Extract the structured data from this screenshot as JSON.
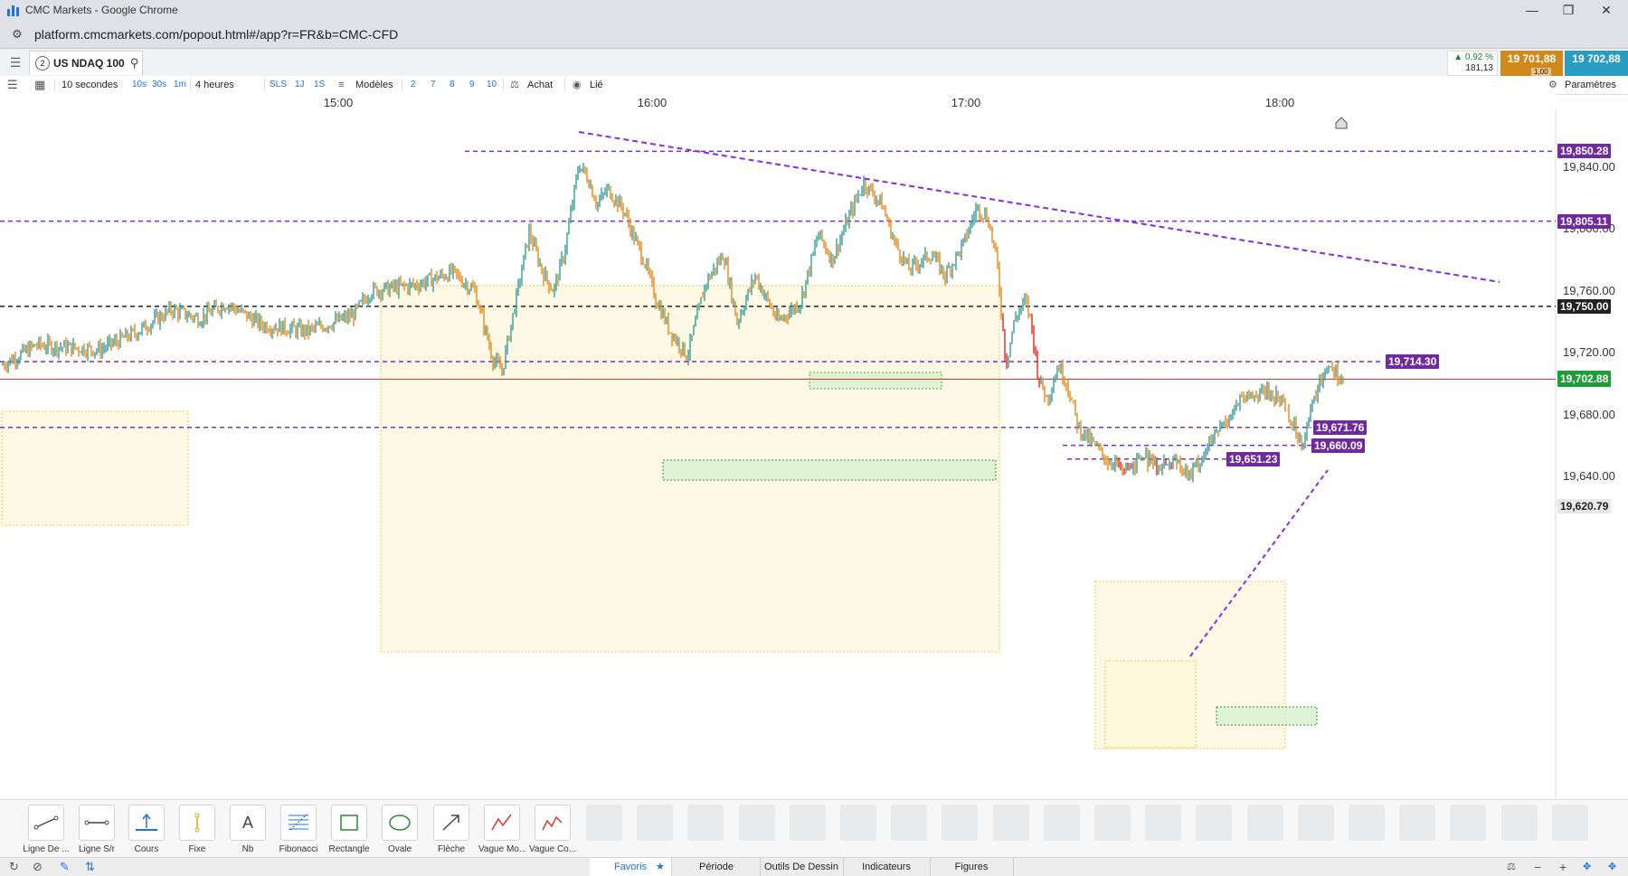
{
  "window": {
    "title": "CMC Markets - Google Chrome",
    "url": "platform.cmcmarkets.com/popout.html#/app?r=FR&b=CMC-CFD"
  },
  "instrument": {
    "tab_count": "2",
    "symbol": "US NDAQ 100",
    "change_pct": "▲ 0,92 %",
    "change_pts": "181,13",
    "sell": "19 701,88",
    "buy": "19 702,88",
    "lot": "1,00"
  },
  "toolbar": {
    "interval": "10 secondes",
    "intervals": [
      "10s",
      "30s",
      "1m"
    ],
    "range": "4 heures",
    "modes": [
      "SLS",
      "1J",
      "1S"
    ],
    "templates": "Modèles",
    "numbers": [
      "2",
      "7",
      "8",
      "9",
      "10"
    ],
    "buy": "Achat",
    "linked": "Lié",
    "settings": "Paramètres"
  },
  "chart_data": {
    "type": "candlestick",
    "instrument": "US NDAQ 100",
    "interval": "10 secondes",
    "x_ticks": [
      "15:00",
      "16:00",
      "17:00",
      "18:00"
    ],
    "y_ticks": [
      "19,840.00",
      "19,800.00",
      "19,760.00",
      "19,720.00",
      "19,680.00",
      "19,640.00"
    ],
    "ylim": [
      19620.79,
      19860
    ],
    "current_price": 19702.88,
    "current_price_label": "19,702.88",
    "axis_bottom_label": "19,620.79",
    "horizontal_lines": [
      {
        "value": 19850.28,
        "label": "19,850.28",
        "style": "dashed",
        "color": "#7b2fbf"
      },
      {
        "value": 19805.11,
        "label": "19,805.11",
        "style": "dashed",
        "color": "#7b2fbf"
      },
      {
        "value": 19750.0,
        "label": "19,750.00",
        "style": "dashed",
        "color": "#222222"
      },
      {
        "value": 19714.3,
        "label": "19,714.30",
        "style": "dashed",
        "color": "#7b2fbf"
      },
      {
        "value": 19671.76,
        "label": "19,671.76",
        "style": "dashed",
        "color": "#7b2fbf"
      },
      {
        "value": 19660.09,
        "label": "19,660.09",
        "style": "dashed",
        "color": "#7b2fbf"
      },
      {
        "value": 19651.23,
        "label": "19,651.23",
        "style": "dashed",
        "color": "#7b2fbf"
      }
    ],
    "colors": {
      "up": "#3a9a9a",
      "down": "#e08a1c",
      "strong_down": "#e0281c",
      "trend": "#8a2be2",
      "current": "#e2382b"
    }
  },
  "tools": [
    {
      "label": "Ligne De ...",
      "icon": "line-tool-icon"
    },
    {
      "label": "Ligne S/r",
      "icon": "sr-line-icon"
    },
    {
      "label": "Cours",
      "icon": "price-line-icon"
    },
    {
      "label": "Fixe",
      "icon": "fixed-line-icon"
    },
    {
      "label": "Nb",
      "icon": "text-tool-icon"
    },
    {
      "label": "Fibonacci",
      "icon": "fibonacci-icon"
    },
    {
      "label": "Rectangle",
      "icon": "rectangle-tool-icon"
    },
    {
      "label": "Ovale",
      "icon": "oval-tool-icon"
    },
    {
      "label": "Flèche",
      "icon": "arrow-tool-icon"
    },
    {
      "label": "Vague Mo...",
      "icon": "wave-tool-icon"
    },
    {
      "label": "Vague Co...",
      "icon": "wave-corrective-icon"
    }
  ],
  "bottom_tabs": [
    "Favoris",
    "Période",
    "Outils De Dessin",
    "Indicateurs",
    "Figures"
  ],
  "text_tool_glyph": "A"
}
